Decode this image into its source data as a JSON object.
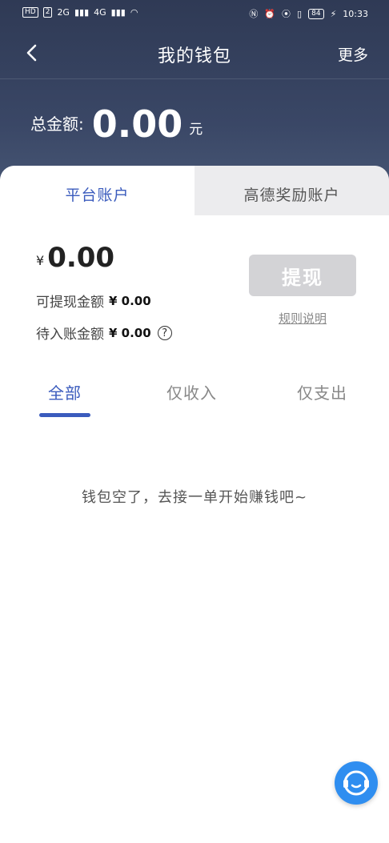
{
  "status_bar": {
    "left_items": [
      "HD",
      "2",
      "2G",
      "4G"
    ],
    "battery": "84",
    "time": "10:33"
  },
  "nav": {
    "title": "我的钱包",
    "more": "更多"
  },
  "summary": {
    "total_label": "总金额:",
    "total_amount": "0.00",
    "total_unit": "元"
  },
  "account_tabs": [
    {
      "label": "平台账户",
      "active": true
    },
    {
      "label": "高德奖励账户",
      "active": false
    }
  ],
  "balance": {
    "currency_symbol": "¥",
    "value": "0.00",
    "withdrawable_label": "可提现金额",
    "withdrawable_value": "¥ 0.00",
    "pending_label": "待入账金额",
    "pending_value": "¥ 0.00",
    "help_symbol": "?"
  },
  "actions": {
    "withdraw": "提现",
    "rules": "规则说明"
  },
  "filters": [
    {
      "label": "全部",
      "active": true
    },
    {
      "label": "仅收入",
      "active": false
    },
    {
      "label": "仅支出",
      "active": false
    }
  ],
  "empty_state": "钱包空了，去接一单开始赚钱吧~",
  "colors": {
    "accent": "#3a5bbd",
    "header": "#3a4766",
    "service": "#2f8ef0"
  }
}
